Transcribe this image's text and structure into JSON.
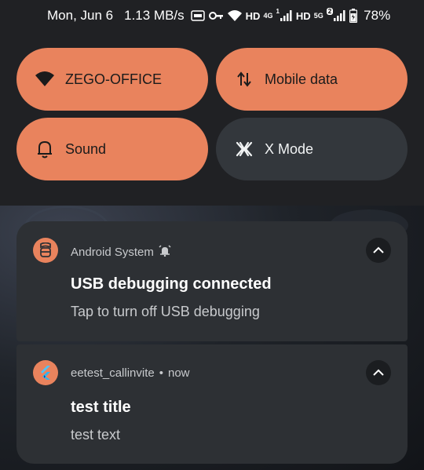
{
  "status_bar": {
    "date": "Mon, Jun 6",
    "speed": "1.13 MB/s",
    "icons": [
      "auto-icon",
      "key-icon",
      "wifi-icon",
      "signal-icon",
      "battery-icon"
    ],
    "hd1": "HD",
    "net1": "4G",
    "sim1": "1",
    "hd2": "HD",
    "net2": "5G",
    "sim2": "2",
    "battery": "78%"
  },
  "tiles": [
    {
      "label": "ZEGO-OFFICE",
      "icon": "wifi-icon",
      "state": "on"
    },
    {
      "label": "Mobile data",
      "icon": "mobile-data-icon",
      "state": "on"
    },
    {
      "label": "Sound",
      "icon": "bell-icon",
      "state": "on"
    },
    {
      "label": "X Mode",
      "icon": "x-mode-icon",
      "state": "off"
    }
  ],
  "notifications": [
    {
      "app": "Android System",
      "title": "USB debugging connected",
      "text": "Tap to turn off USB debugging",
      "icon": "android-system-icon"
    },
    {
      "app": "eetest_callinvite",
      "time": "now",
      "title": "test title",
      "text": "test text",
      "icon": "flutter-icon"
    }
  ],
  "colors": {
    "accent": "#e9835d",
    "tile_off": "#33373c",
    "card": "#2d3034",
    "background": "#202124"
  }
}
